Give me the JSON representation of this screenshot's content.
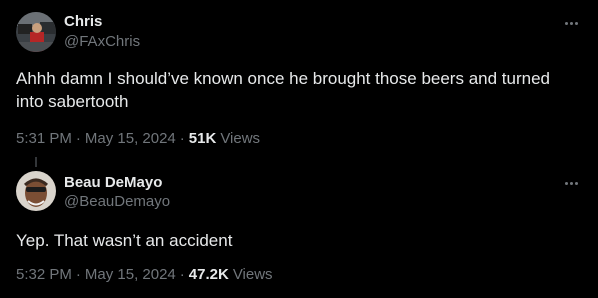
{
  "tweets": [
    {
      "author": {
        "name": "Chris",
        "handle": "@FAxChris"
      },
      "text": "Ahhh damn I should’ve known once he brought those beers and turned into sabertooth",
      "time": "5:31 PM",
      "date": "May 15, 2024",
      "views_count": "51K",
      "views_label": "Views"
    },
    {
      "author": {
        "name": "Beau DeMayo",
        "handle": "@BeauDemayo"
      },
      "text": "Yep. That wasn’t an accident",
      "time": "5:32 PM",
      "date": "May 15, 2024",
      "views_count": "47.2K",
      "views_label": "Views"
    }
  ],
  "separator": "·",
  "icons": {
    "more": "more-horizontal-icon"
  },
  "colors": {
    "background": "#000000",
    "text": "#e7e9ea",
    "secondary": "#71767b"
  }
}
